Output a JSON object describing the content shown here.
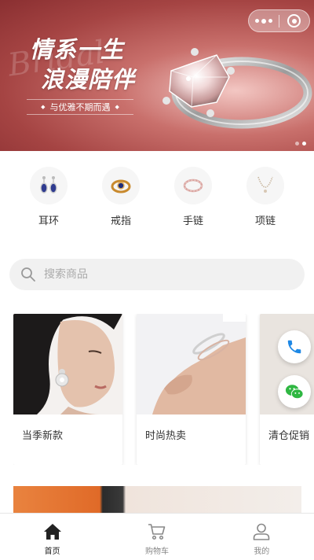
{
  "banner": {
    "headline_line1": "情系一生",
    "headline_line2": "浪漫陪伴",
    "tagline": "与优雅不期而遇",
    "script_text": "Bridal",
    "slide_count": 2,
    "active_slide": 2
  },
  "categories": [
    {
      "label": "耳环",
      "icon": "earring-icon"
    },
    {
      "label": "戒指",
      "icon": "ring-icon"
    },
    {
      "label": "手链",
      "icon": "bracelet-icon"
    },
    {
      "label": "项链",
      "icon": "necklace-icon"
    }
  ],
  "search": {
    "placeholder": "搜索商品"
  },
  "products": [
    {
      "name": "当季新款",
      "image": "model-earring-photo"
    },
    {
      "name": "时尚热卖",
      "image": "wrist-bracelet-photo"
    },
    {
      "name": "清仓促销",
      "image": "promo-photo"
    }
  ],
  "floating": {
    "phone_icon": "phone-icon",
    "wechat_icon": "wechat-icon"
  },
  "tabbar": {
    "items": [
      {
        "label": "首页",
        "icon": "home-icon",
        "active": true
      },
      {
        "label": "购物车",
        "icon": "cart-icon",
        "active": false
      },
      {
        "label": "我的",
        "icon": "user-icon",
        "active": false
      }
    ]
  },
  "colors": {
    "banner_red": "#a54443",
    "phone_blue": "#1e88e5",
    "wechat_green": "#2fb742",
    "search_bg": "#f1f1f1"
  }
}
